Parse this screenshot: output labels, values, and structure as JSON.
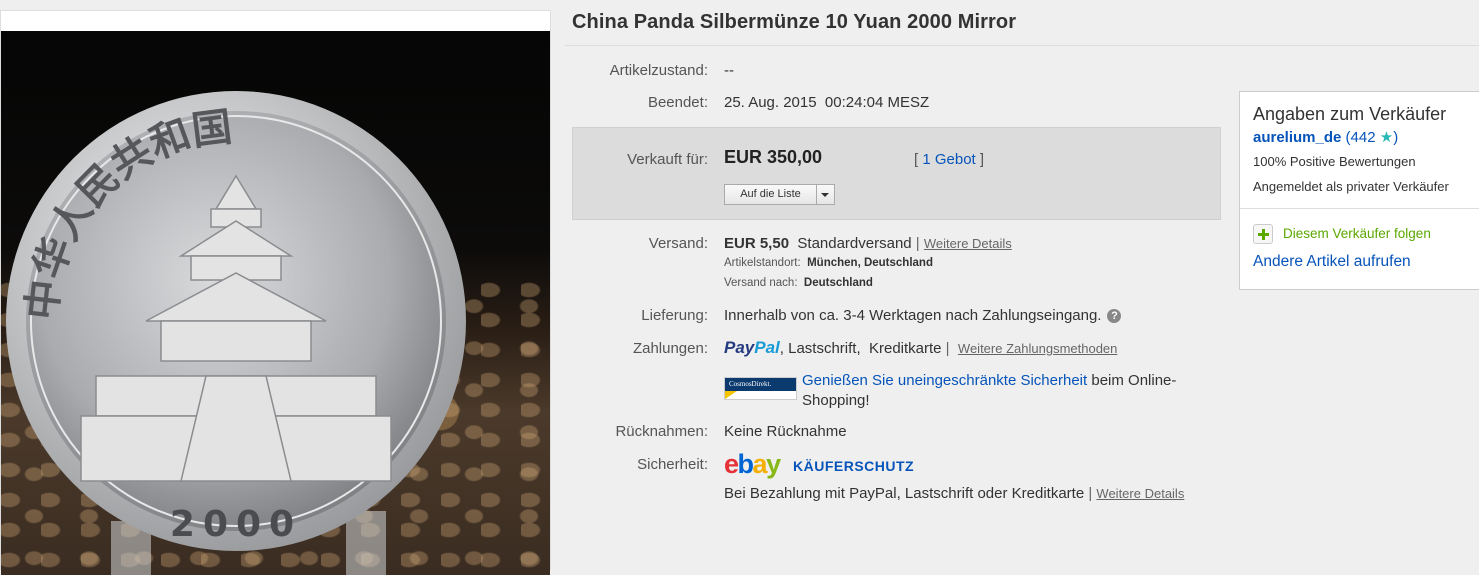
{
  "photo": {
    "coin_legend": "中华人民共和国",
    "coin_year": "2000"
  },
  "listing": {
    "title": "China Panda Silbermünze 10 Yuan 2000 Mirror",
    "condition_label": "Artikelzustand:",
    "condition_value": "--",
    "ended_label": "Beendet:",
    "ended_value": "25. Aug. 2015  00:24:04 MESZ",
    "sold_label": "Verkauft für:",
    "price": "EUR 350,00",
    "bids_open": "[ ",
    "bids_link": "1 Gebot",
    "bids_close": " ]",
    "watch_button": "Auf die Liste",
    "shipping_label": "Versand:",
    "shipping_price": "EUR 5,50",
    "shipping_method": "Standardversand",
    "shipping_sep": " | ",
    "shipping_details": "Weitere Details",
    "location_label": "Artikelstandort:",
    "location_value": "München, Deutschland",
    "ships_to_label": "Versand nach:",
    "ships_to_value": "Deutschland",
    "delivery_label": "Lieferung:",
    "delivery_value": "Innerhalb von ca. 3-4 Werktagen nach Zahlungseingang.",
    "help_glyph": "?",
    "payments_label": "Zahlungen:",
    "paypal_part1": "Pay",
    "paypal_part2": "Pal",
    "payments_methods": ", Lastschrift,  Kreditkarte",
    "payments_sep": " | ",
    "payments_more": "Weitere Zahlungsmethoden",
    "cosmos_text": "CosmosDirekt.",
    "cosmos_link": "Genießen Sie uneingeschränkte Sicherheit",
    "cosmos_rest1": " beim Online-",
    "cosmos_rest2": "Shopping!",
    "returns_label": "Rücknahmen:",
    "returns_value": "Keine Rücknahme",
    "security_label": "Sicherheit:",
    "ebay_e": "e",
    "ebay_b": "b",
    "ebay_a": "a",
    "ebay_y": "y",
    "buyer_protection": "KÄUFERSCHUTZ",
    "protection_text": "Bei Bezahlung mit PayPal, Lastschrift oder Kreditkarte",
    "protection_sep": " | ",
    "protection_details": "Weitere Details"
  },
  "seller": {
    "heading": "Angaben zum Verkäufer",
    "name": "aurelium_de",
    "score_open": " (",
    "score": "442",
    "star": "★",
    "score_close": ")",
    "positive": "100% Positive Bewertungen",
    "registered": "Angemeldet als privater Verkäufer",
    "follow": "Diesem Verkäufer folgen",
    "other_items": "Andere Artikel aufrufen"
  },
  "colors": {
    "link_blue": "#0654ba",
    "price_box": "#dcdcdc",
    "follow_green": "#5ba800",
    "star_teal": "#28b9b4"
  }
}
